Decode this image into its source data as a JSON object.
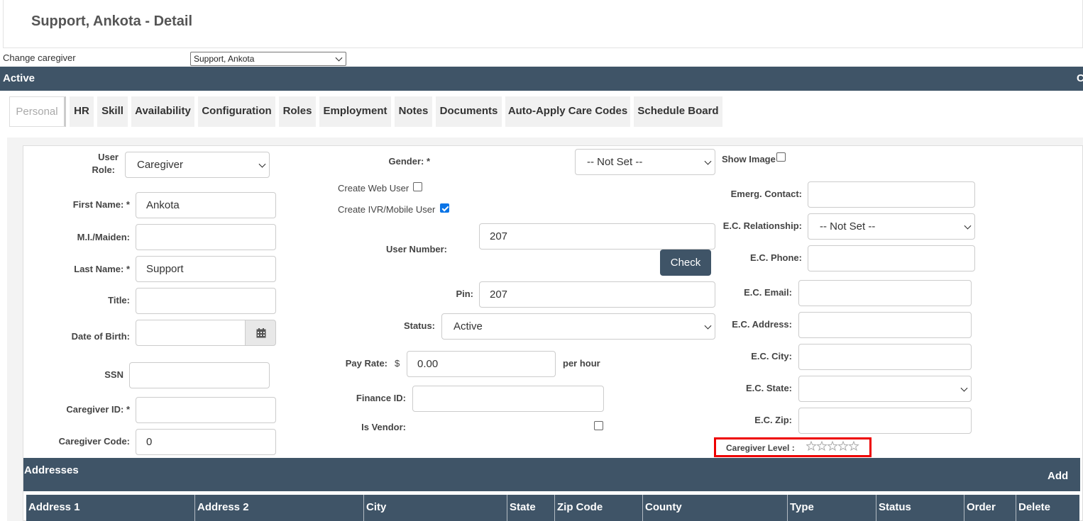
{
  "header": {
    "title": "Support, Ankota - Detail"
  },
  "change_caregiver": {
    "label": "Change caregiver",
    "selected": "Support, Ankota"
  },
  "status_bar": {
    "label": "Active",
    "right_cut": "C"
  },
  "tabs": [
    {
      "label": "Personal"
    },
    {
      "label": "HR"
    },
    {
      "label": "Skill"
    },
    {
      "label": "Availability"
    },
    {
      "label": "Configuration"
    },
    {
      "label": "Roles"
    },
    {
      "label": "Employment"
    },
    {
      "label": "Notes"
    },
    {
      "label": "Documents"
    },
    {
      "label": "Auto-Apply Care Codes"
    },
    {
      "label": "Schedule Board"
    }
  ],
  "col1": {
    "user_role_label_1": "User",
    "user_role_label_2": "Role:",
    "user_role_value": "Caregiver",
    "first_name_label": "First Name: *",
    "first_name_value": "Ankota",
    "mi_label": "M.I./Maiden:",
    "mi_value": "",
    "last_name_label": "Last Name: *",
    "last_name_value": "Support",
    "title_label": "Title:",
    "title_value": "",
    "dob_label": "Date of Birth:",
    "dob_value": "",
    "ssn_label": "SSN",
    "ssn_value": "",
    "caregiver_id_label": "Caregiver ID: *",
    "caregiver_id_value": "",
    "caregiver_code_label": "Caregiver Code:",
    "caregiver_code_value": "0"
  },
  "col2": {
    "gender_label": "Gender: *",
    "gender_value": "-- Not Set --",
    "create_web_user_label": "Create Web User",
    "create_web_user_checked": false,
    "create_ivr_label": "Create IVR/Mobile User",
    "create_ivr_checked": true,
    "user_number_label": "User Number:",
    "user_number_value": "207",
    "check_button": "Check",
    "pin_label": "Pin:",
    "pin_value": "207",
    "status_label": "Status:",
    "status_value": "Active",
    "pay_rate_label": "Pay Rate:",
    "pay_rate_currency": "$",
    "pay_rate_value": "0.00",
    "pay_rate_unit": "per hour",
    "finance_id_label": "Finance ID:",
    "finance_id_value": "",
    "is_vendor_label": "Is Vendor:",
    "is_vendor_checked": false
  },
  "col3": {
    "show_image_label": "Show Image",
    "show_image_checked": false,
    "emerg_contact_label": "Emerg. Contact:",
    "emerg_contact_value": "",
    "ec_relationship_label": "E.C. Relationship:",
    "ec_relationship_value": "-- Not Set --",
    "ec_phone_label": "E.C. Phone:",
    "ec_phone_value": "",
    "ec_email_label": "E.C. Email:",
    "ec_email_value": "",
    "ec_address_label": "E.C. Address:",
    "ec_address_value": "",
    "ec_city_label": "E.C. City:",
    "ec_city_value": "",
    "ec_state_label": "E.C. State:",
    "ec_state_value": "",
    "ec_zip_label": "E.C. Zip:",
    "ec_zip_value": "",
    "caregiver_level_label": "Caregiver Level :",
    "caregiver_level_stars_filled": 0,
    "caregiver_level_stars_total": 5
  },
  "addresses": {
    "title": "Addresses",
    "add_label": "Add",
    "columns": [
      "Address 1",
      "Address 2",
      "City",
      "State",
      "Zip Code",
      "County",
      "Type",
      "Status",
      "Order",
      "Delete"
    ]
  },
  "colors": {
    "brand_bar": "#3f5467",
    "highlight": "#ee0000",
    "checkbox_on": "#0a74e6"
  },
  "icons": {
    "calendar": "calendar-icon",
    "star": "star-outline-icon",
    "chevron": "chevron-down-icon"
  }
}
